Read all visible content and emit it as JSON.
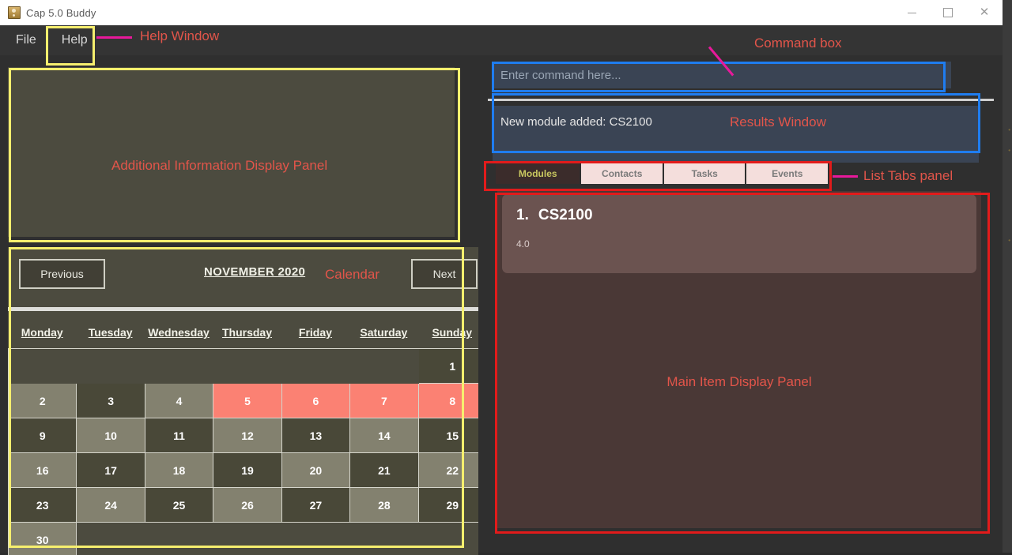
{
  "window": {
    "title": "Cap 5.0 Buddy",
    "icon": "app-icon",
    "controls": {
      "minimize": "minimize-icon",
      "maximize": "maximize-icon",
      "close": "close-icon"
    }
  },
  "menubar": {
    "items": [
      {
        "label": "File"
      },
      {
        "label": "Help"
      }
    ]
  },
  "info_panel": {
    "annotation": "Additional Information Display Panel"
  },
  "calendar": {
    "prev_label": "Previous",
    "next_label": "Next",
    "month_title": "NOVEMBER 2020",
    "annotation": "Calendar",
    "daynames": [
      "Monday",
      "Tuesday",
      "Wednesday",
      "Thursday",
      "Friday",
      "Saturday",
      "Sunday"
    ],
    "leading_blanks": 6,
    "days": [
      {
        "n": "1",
        "style": "empty"
      },
      {
        "n": "2",
        "style": "light"
      },
      {
        "n": "3",
        "style": "dark"
      },
      {
        "n": "4",
        "style": "light"
      },
      {
        "n": "5",
        "style": "hl"
      },
      {
        "n": "6",
        "style": "hl"
      },
      {
        "n": "7",
        "style": "hl"
      },
      {
        "n": "8",
        "style": "hl"
      },
      {
        "n": "9",
        "style": "dark"
      },
      {
        "n": "10",
        "style": "light"
      },
      {
        "n": "11",
        "style": "dark"
      },
      {
        "n": "12",
        "style": "light"
      },
      {
        "n": "13",
        "style": "dark"
      },
      {
        "n": "14",
        "style": "light"
      },
      {
        "n": "15",
        "style": "dark"
      },
      {
        "n": "16",
        "style": "light"
      },
      {
        "n": "17",
        "style": "dark"
      },
      {
        "n": "18",
        "style": "light"
      },
      {
        "n": "19",
        "style": "dark"
      },
      {
        "n": "20",
        "style": "light"
      },
      {
        "n": "21",
        "style": "dark"
      },
      {
        "n": "22",
        "style": "light"
      },
      {
        "n": "23",
        "style": "dark"
      },
      {
        "n": "24",
        "style": "light"
      },
      {
        "n": "25",
        "style": "dark"
      },
      {
        "n": "26",
        "style": "light"
      },
      {
        "n": "27",
        "style": "dark"
      },
      {
        "n": "28",
        "style": "light"
      },
      {
        "n": "29",
        "style": "dark"
      },
      {
        "n": "30",
        "style": "light"
      }
    ]
  },
  "command_box": {
    "placeholder": "Enter command here...",
    "value": ""
  },
  "results": {
    "text": "New module added: CS2100",
    "annotation": "Results Window"
  },
  "tabs": {
    "items": [
      {
        "label": "Modules",
        "active": true
      },
      {
        "label": "Contacts",
        "active": false
      },
      {
        "label": "Tasks",
        "active": false
      },
      {
        "label": "Events",
        "active": false
      }
    ],
    "annotation": "List Tabs panel"
  },
  "main_panel": {
    "annotation": "Main Item Display Panel",
    "items": [
      {
        "index": "1.",
        "title": "CS2100",
        "subtitle": "4.0"
      }
    ]
  },
  "annotations": {
    "help_window": "Help Window",
    "command_box": "Command box",
    "colors": {
      "highlight_yellow": "#f6ef6e",
      "highlight_blue": "#1f7df0",
      "highlight_red": "#e21b1b",
      "label_red": "#e2554a",
      "arrow_pink": "#e8199b"
    }
  }
}
